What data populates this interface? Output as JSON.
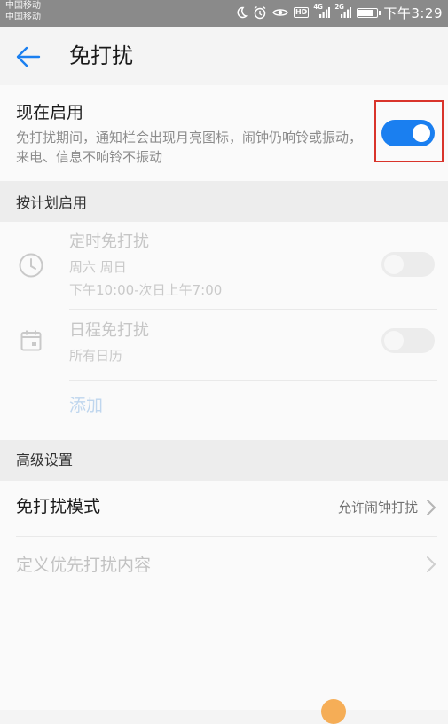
{
  "status_bar": {
    "carrier_1": "中国移动",
    "carrier_2": "中国移动",
    "net_type_1": "4G",
    "net_type_2": "2G",
    "hd_label": "HD",
    "battery_level": 0.85,
    "time": "下午3:29",
    "icons": [
      "moon-icon",
      "alarm-icon",
      "eye-icon",
      "hd-icon",
      "signal-icon",
      "battery-icon"
    ]
  },
  "app_bar": {
    "back_icon": "arrow-left-icon",
    "title": "免打扰"
  },
  "now_enabled": {
    "title": "现在启用",
    "description": "免打扰期间，通知栏会出现月亮图标，闹钟仍响铃或振动，来电、信息不响铃不振动",
    "toggle_on": true
  },
  "schedule": {
    "header": "按计划启用",
    "timed": {
      "icon": "clock-icon",
      "title": "定时免打扰",
      "days": "周六 周日",
      "time_range": "下午10:00-次日上午7:00",
      "toggle_on": false
    },
    "calendar": {
      "icon": "calendar-icon",
      "title": "日程免打扰",
      "subtitle": "所有日历",
      "toggle_on": false
    },
    "add_label": "添加"
  },
  "advanced": {
    "header": "高级设置",
    "mode": {
      "title": "免打扰模式",
      "value": "允许闹钟打扰"
    },
    "priority": {
      "title": "定义优先打扰内容"
    }
  },
  "colors": {
    "accent": "#1a7ff0",
    "highlight": "#d9342b",
    "status_bar": "#8a8a8a",
    "section_bg": "#ededed"
  }
}
